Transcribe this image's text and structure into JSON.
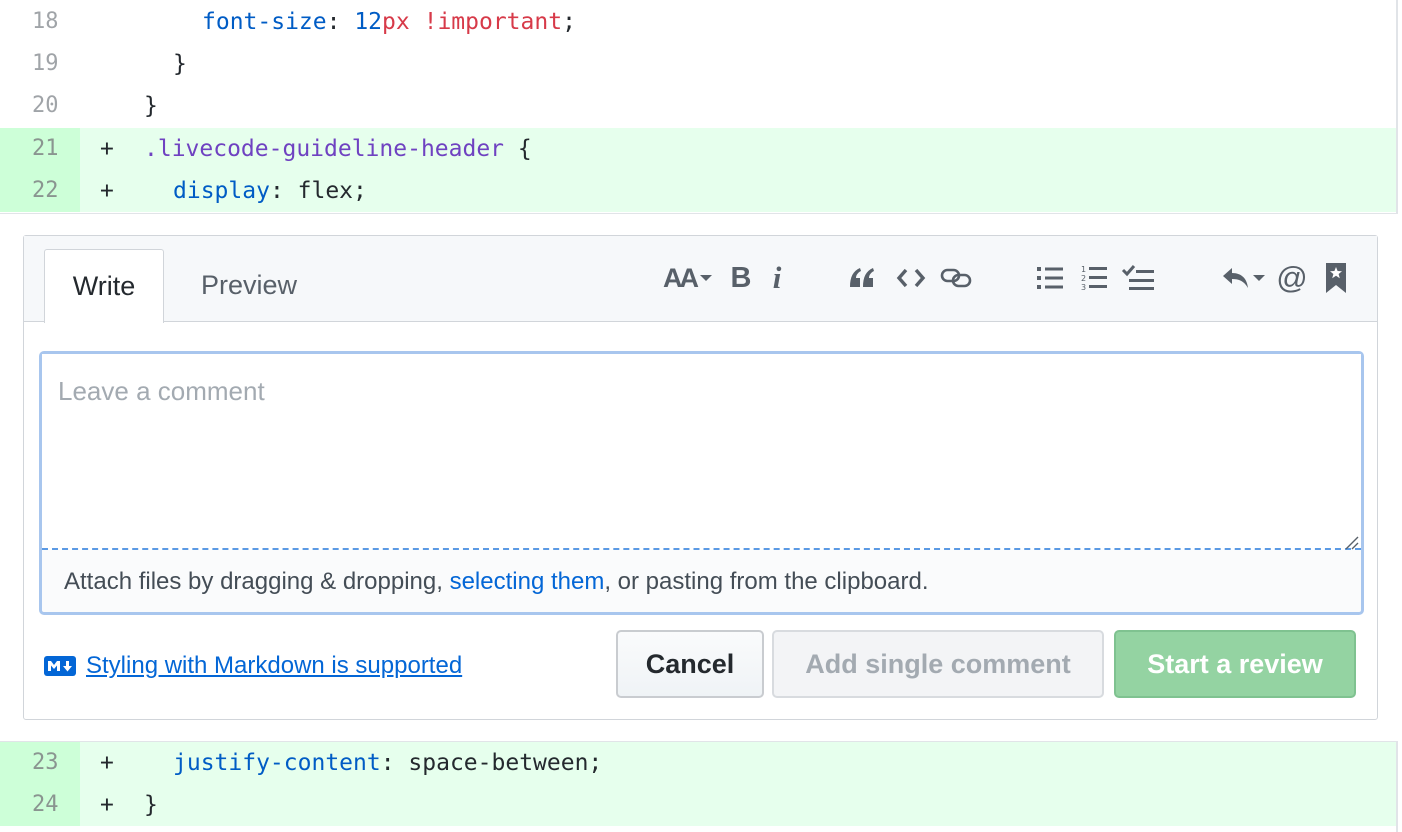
{
  "diff_top": [
    {
      "num": "18",
      "sign": "",
      "indent": "    ",
      "tokens": [
        [
          "prop",
          "font-size"
        ],
        [
          "plain",
          ": "
        ],
        [
          "num",
          "12"
        ],
        [
          "unit",
          "px"
        ],
        [
          "plain",
          " "
        ],
        [
          "imp",
          "!important"
        ],
        [
          "plain",
          ";"
        ]
      ]
    },
    {
      "num": "19",
      "sign": "",
      "indent": "  ",
      "tokens": [
        [
          "plain",
          "}"
        ]
      ]
    },
    {
      "num": "20",
      "sign": "",
      "indent": "",
      "tokens": [
        [
          "plain",
          "}"
        ]
      ]
    },
    {
      "num": "21",
      "sign": "+",
      "indent": "",
      "tokens": [
        [
          "sel",
          ".livecode-guideline-header"
        ],
        [
          "plain",
          " {"
        ]
      ]
    },
    {
      "num": "22",
      "sign": "+",
      "indent": "  ",
      "tokens": [
        [
          "prop",
          "display"
        ],
        [
          "plain",
          ": flex;"
        ]
      ]
    }
  ],
  "diff_bottom": [
    {
      "num": "23",
      "sign": "+",
      "indent": "  ",
      "tokens": [
        [
          "prop",
          "justify-content"
        ],
        [
          "plain",
          ": space-between;"
        ]
      ]
    },
    {
      "num": "24",
      "sign": "+",
      "indent": "",
      "tokens": [
        [
          "plain",
          "}"
        ]
      ]
    }
  ],
  "tabs": {
    "write": "Write",
    "preview": "Preview"
  },
  "toolbar": {
    "header_label": "AA",
    "bold_label": "B",
    "italic_label": "i",
    "mention_label": "@",
    "icons": [
      "text-size-icon",
      "bold-icon",
      "italic-icon",
      "quote-icon",
      "code-icon",
      "link-icon",
      "bulleted-list-icon",
      "numbered-list-icon",
      "task-list-icon",
      "reply-icon",
      "mention-icon",
      "bookmark-icon"
    ]
  },
  "comment": {
    "placeholder": "Leave a comment",
    "value": ""
  },
  "attach": {
    "before": "Attach files by dragging & dropping, ",
    "link": "selecting them",
    "after": ", or pasting from the clipboard."
  },
  "markdown_hint": "Styling with Markdown is supported",
  "buttons": {
    "cancel": "Cancel",
    "add_single": "Add single comment",
    "start_review": "Start a review"
  },
  "colors": {
    "added_bg": "#e6ffed",
    "added_num_bg": "#cdffd8",
    "link": "#0366d6",
    "review_button": "#94d3a2"
  }
}
